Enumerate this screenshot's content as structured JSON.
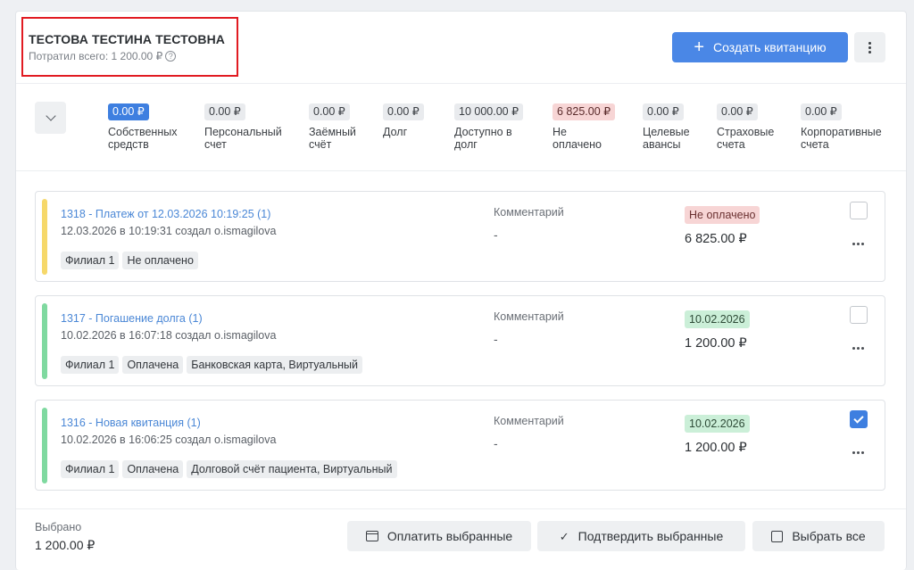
{
  "client": {
    "name": "ТЕСТОВА ТЕСТИНА ТЕСТОВНА",
    "spent": "Потратил всего: 1 200.00 ₽",
    "help_icon": "?"
  },
  "header": {
    "create_button_icon": "+",
    "create_button_label": "Создать квитанцию",
    "more_icon": "more-vertical-icon"
  },
  "balances": [
    {
      "amount": "0.00 ₽",
      "label": "Собственных средств",
      "style": "blue"
    },
    {
      "amount": "0.00 ₽",
      "label": "Персональный счет",
      "style": "grey"
    },
    {
      "amount": "0.00 ₽",
      "label": "Заёмный счёт",
      "style": "grey"
    },
    {
      "amount": "0.00 ₽",
      "label": "Долг",
      "style": "grey"
    },
    {
      "amount": "10 000.00 ₽",
      "label": "Доступно в долг",
      "style": "grey"
    },
    {
      "amount": "6 825.00 ₽",
      "label": "Не оплачено",
      "style": "red"
    },
    {
      "amount": "0.00 ₽",
      "label": "Целевые авансы",
      "style": "grey"
    },
    {
      "amount": "0.00 ₽",
      "label": "Страховые счета",
      "style": "grey"
    },
    {
      "amount": "0.00 ₽",
      "label": "Корпоративные счета",
      "style": "grey"
    }
  ],
  "receipts": [
    {
      "title": "1318 - Платеж от 12.03.2026 10:19:25 (1)",
      "subtitle": "12.03.2026 в 10:19:31 создал o.ismagilova",
      "tags": [
        "Филиал 1",
        "Не оплачено"
      ],
      "comment_label": "Комментарий",
      "comment_value": "-",
      "status": "Не оплачено",
      "status_style": "red",
      "amount": "6 825.00 ₽",
      "stripe_color": "#f6d86a",
      "checked": false
    },
    {
      "title": "1317 - Погашение долга (1)",
      "subtitle": "10.02.2026 в 16:07:18 создал o.ismagilova",
      "tags": [
        "Филиал 1",
        "Оплачена",
        "Банковская карта, Виртуальный"
      ],
      "comment_label": "Комментарий",
      "comment_value": "-",
      "status": "10.02.2026",
      "status_style": "green",
      "amount": "1 200.00 ₽",
      "stripe_color": "#7fd9a0",
      "checked": false
    },
    {
      "title": "1316 - Новая квитанция (1)",
      "subtitle": "10.02.2026 в 16:06:25 создал o.ismagilova",
      "tags": [
        "Филиал 1",
        "Оплачена",
        "Долговой счёт пациента, Виртуальный"
      ],
      "comment_label": "Комментарий",
      "comment_value": "-",
      "status": "10.02.2026",
      "status_style": "green",
      "amount": "1 200.00 ₽",
      "stripe_color": "#7fd9a0",
      "checked": true
    }
  ],
  "footer": {
    "selected_label": "Выбрано",
    "selected_value": "1 200.00 ₽",
    "pay_selected": "Оплатить выбранные",
    "confirm_selected": "Подтвердить выбранные",
    "select_all": "Выбрать все"
  },
  "colors": {
    "accent": "#4a87e6",
    "highlight_border": "#e11b22"
  }
}
